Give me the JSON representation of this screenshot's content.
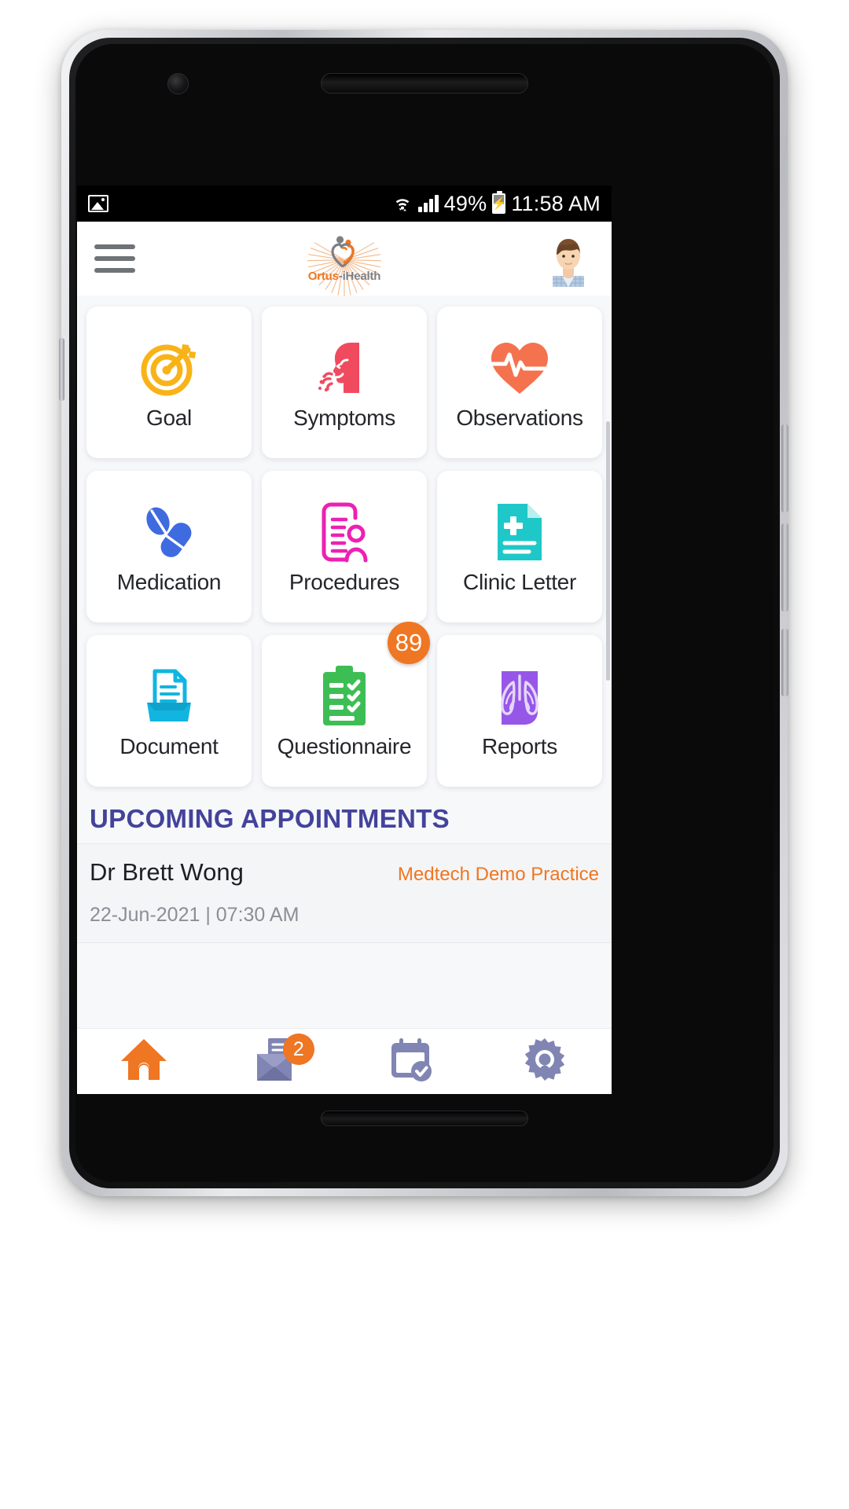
{
  "status_bar": {
    "photo_icon": "image-icon",
    "wifi_icon": "wifi-icon",
    "signal_icon": "cellular-signal-icon",
    "battery_percent": "49%",
    "battery_icon": "battery-charging-icon",
    "time": "11:58 AM"
  },
  "header": {
    "menu_icon": "hamburger-menu-icon",
    "logo_text_primary": "Ortus",
    "logo_text_secondary": "-iHealth",
    "logo_icon": "ortus-ihealth-logo-icon",
    "avatar_icon": "user-avatar-icon"
  },
  "tiles": [
    {
      "label": "Goal",
      "icon": "target-goal-icon",
      "color": "#F9B318",
      "badge": null
    },
    {
      "label": "Symptoms",
      "icon": "sneezing-head-icon",
      "color": "#F04A5F",
      "badge": null
    },
    {
      "label": "Observations",
      "icon": "heart-pulse-icon",
      "color": "#F5724E",
      "badge": null
    },
    {
      "label": "Medication",
      "icon": "pills-capsule-icon",
      "color": "#3F6BE0",
      "badge": null
    },
    {
      "label": "Procedures",
      "icon": "clipboard-person-icon",
      "color": "#EC21B4",
      "badge": null
    },
    {
      "label": "Clinic Letter",
      "icon": "medical-document-icon",
      "color": "#1FC8C8",
      "badge": null
    },
    {
      "label": "Document",
      "icon": "document-scan-icon",
      "color": "#12B5E0",
      "badge": null
    },
    {
      "label": "Questionnaire",
      "icon": "checklist-clipboard-icon",
      "color": "#3DBE55",
      "badge": "89"
    },
    {
      "label": "Reports",
      "icon": "lungs-xray-icon",
      "color": "#9657E8",
      "badge": null
    }
  ],
  "appointments": {
    "section_title": "UPCOMING APPOINTMENTS",
    "items": [
      {
        "doctor": "Dr Brett Wong",
        "practice": "Medtech Demo Practice",
        "datetime": "22-Jun-2021 | 07:30 AM"
      }
    ]
  },
  "bottom_nav": [
    {
      "name": "home",
      "icon": "home-icon",
      "active": true,
      "badge": null
    },
    {
      "name": "messages",
      "icon": "mail-document-icon",
      "active": false,
      "badge": "2"
    },
    {
      "name": "appointments",
      "icon": "calendar-check-icon",
      "active": false,
      "badge": null
    },
    {
      "name": "settings",
      "icon": "gear-icon",
      "active": false,
      "badge": null
    }
  ],
  "colors": {
    "accent_orange": "#EF7622",
    "heading_purple": "#43439B",
    "nav_inactive": "#8185B3",
    "screen_bg": "#F7F8FA"
  }
}
